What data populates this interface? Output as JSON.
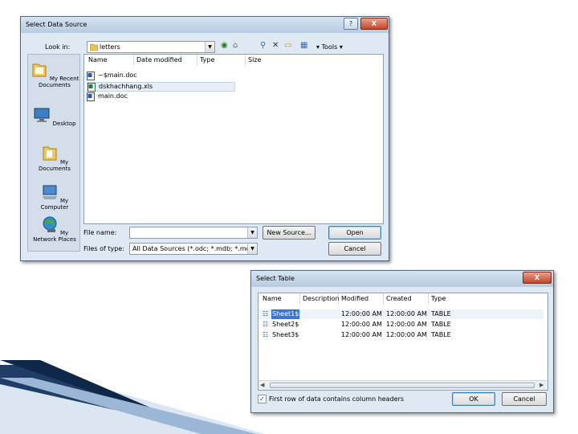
{
  "data_source_dialog": {
    "title": "Select Data Source",
    "help_button": "?",
    "close_button": "X",
    "look_in_label": "Look in:",
    "look_in_value": "letters",
    "tools_label": "Tools",
    "places": [
      {
        "label": "My Recent Documents",
        "icon": "recent-documents-icon"
      },
      {
        "label": "Desktop",
        "icon": "desktop-icon"
      },
      {
        "label": "My Documents",
        "icon": "my-documents-icon"
      },
      {
        "label": "My Computer",
        "icon": "my-computer-icon"
      },
      {
        "label": "My Network Places",
        "icon": "network-places-icon"
      }
    ],
    "columns": [
      "Name",
      "Date modified",
      "Type",
      "Size"
    ],
    "files": [
      {
        "name": "~$main.doc",
        "icon": "word-document-icon"
      },
      {
        "name": "dskhachhang.xls",
        "icon": "excel-workbook-icon"
      },
      {
        "name": "main.doc",
        "icon": "word-document-icon"
      }
    ],
    "file_name_label": "File name:",
    "file_name_value": "",
    "files_of_type_label": "Files of type:",
    "files_of_type_value": "All Data Sources (*.odc; *.mdb; *.mde",
    "new_source_button": "New Source...",
    "open_button": "Open",
    "cancel_button": "Cancel"
  },
  "select_table_dialog": {
    "title": "Select Table",
    "close_button": "X",
    "columns": [
      "Name",
      "Description",
      "Modified",
      "Created",
      "Type"
    ],
    "rows": [
      {
        "name": "Sheet1$",
        "description": "",
        "modified": "12:00:00 AM",
        "created": "12:00:00 AM",
        "type": "TABLE"
      },
      {
        "name": "Sheet2$",
        "description": "",
        "modified": "12:00:00 AM",
        "created": "12:00:00 AM",
        "type": "TABLE"
      },
      {
        "name": "Sheet3$",
        "description": "",
        "modified": "12:00:00 AM",
        "created": "12:00:00 AM",
        "type": "TABLE"
      }
    ],
    "first_row_headers_label": "First row of data contains column headers",
    "first_row_headers_checked": true,
    "ok_button": "OK",
    "cancel_button": "Cancel"
  }
}
